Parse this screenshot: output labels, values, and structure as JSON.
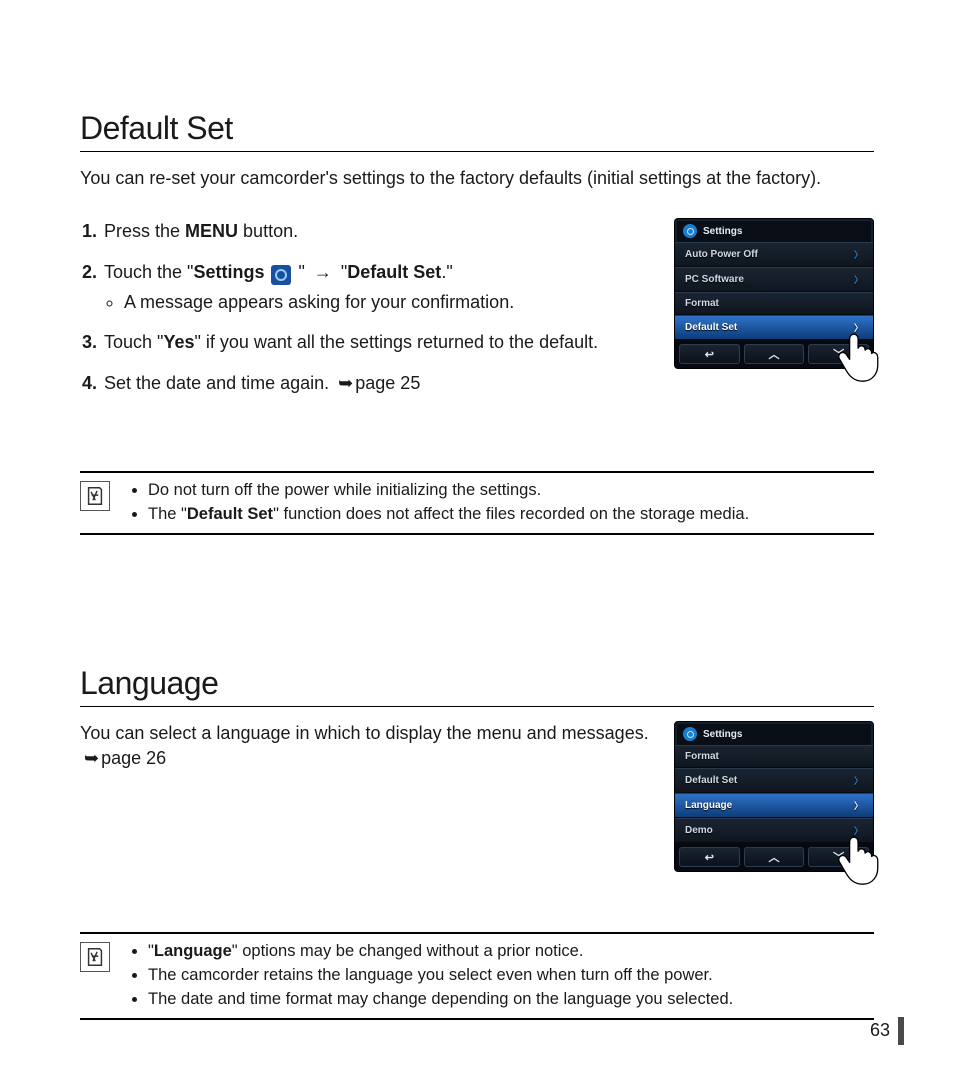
{
  "page_number": "63",
  "default_set": {
    "title": "Default Set",
    "lead": "You can re-set your camcorder's settings to the factory defaults (initial settings at the factory).",
    "step1_a": "Press the ",
    "step1_b": "MENU",
    "step1_c": " button.",
    "step2_a": "Touch the \"",
    "step2_b": "Settings",
    "step2_c": " \" ",
    "step2_d": " \"",
    "step2_e": "Default Set",
    "step2_f": ".\"",
    "step2_sub": "A message appears asking for your confirmation.",
    "step3_a": "Touch \"",
    "step3_b": "Yes",
    "step3_c": "\" if you want all the settings returned to the default.",
    "step4_a": "Set the date and time again. ",
    "step4_b": "page 25",
    "notes": {
      "n1": "Do not turn off the power while initializing the settings.",
      "n2_a": "The \"",
      "n2_b": "Default Set",
      "n2_c": "\" function does not affect the files recorded on the storage media."
    },
    "lcd": {
      "header": "Settings",
      "items": [
        "Auto Power Off",
        "PC Software",
        "Format",
        "Default Set"
      ],
      "selected_index": 3
    }
  },
  "language": {
    "title": "Language",
    "lead_a": "You can select a language in which to display the menu and messages. ",
    "lead_b": "page 26",
    "notes": {
      "n1_a": "\"",
      "n1_b": "Language",
      "n1_c": "\" options may be changed without a prior notice.",
      "n2": "The camcorder retains the language you select even when turn off the power.",
      "n3": "The date and time format may change depending on the language you selected."
    },
    "lcd": {
      "header": "Settings",
      "items": [
        "Format",
        "Default Set",
        "Language",
        "Demo"
      ],
      "selected_index": 2
    }
  }
}
